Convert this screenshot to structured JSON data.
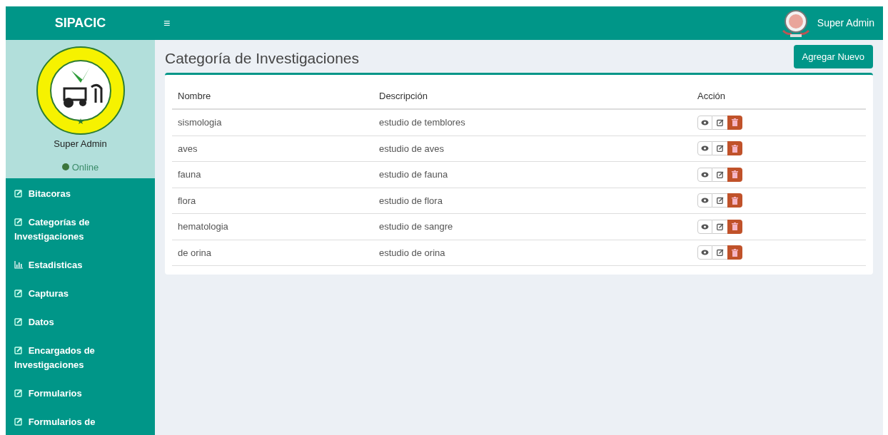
{
  "app_title": "SIPACIC",
  "header": {
    "menu_glyph": "≡",
    "user_name": "Super Admin"
  },
  "sidebar": {
    "user_name": "Super Admin",
    "status": "Online",
    "items": [
      {
        "label": "Bitacoras",
        "kind": "edit"
      },
      {
        "label": "Categorías de Investigaciones",
        "kind": "edit"
      },
      {
        "label": "Estadisticas",
        "kind": "chart"
      },
      {
        "label": "Capturas",
        "kind": "edit"
      },
      {
        "label": "Datos",
        "kind": "edit"
      },
      {
        "label": "Encargados de Investigaciones",
        "kind": "edit"
      },
      {
        "label": "Formularios",
        "kind": "edit"
      },
      {
        "label": "Formularios de",
        "kind": "edit"
      }
    ]
  },
  "page_title": "Categoría de Investigaciones",
  "add_button": "Agregar Nuevo",
  "table": {
    "columns": [
      "Nombre",
      "Descripción",
      "Acción"
    ],
    "rows": [
      {
        "name": "sismologia",
        "description": "estudio de temblores"
      },
      {
        "name": "aves",
        "description": "estudio de aves"
      },
      {
        "name": "fauna",
        "description": "estudio de fauna"
      },
      {
        "name": "flora",
        "description": "estudio de flora"
      },
      {
        "name": "hematologia",
        "description": "estudio de sangre"
      },
      {
        "name": "de orina",
        "description": "estudio de orina"
      }
    ]
  }
}
